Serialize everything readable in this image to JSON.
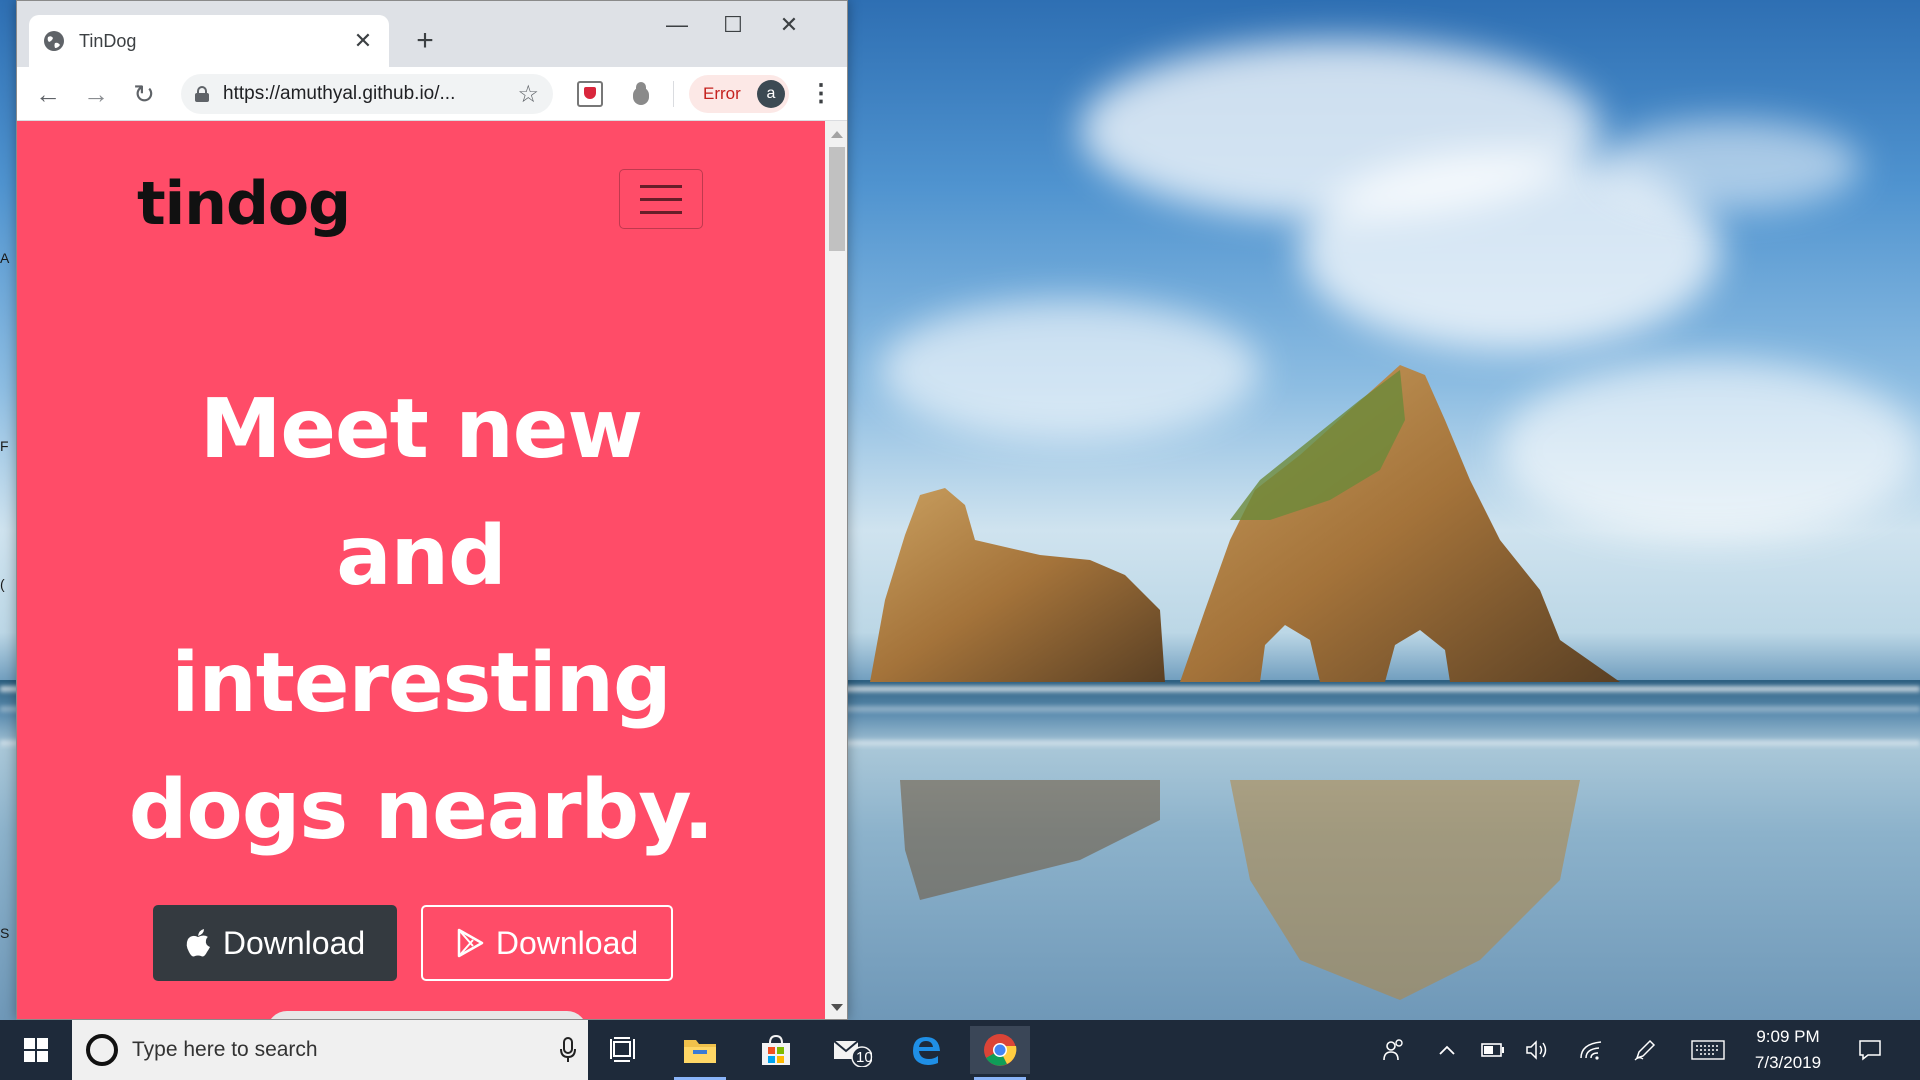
{
  "browser": {
    "tab_title": "TinDog",
    "tab_close": "✕",
    "new_tab": "+",
    "url": "https://amuthyal.github.io/...",
    "error_label": "Error",
    "profile_initial": "a",
    "window_controls": {
      "minimize": "—",
      "maximize": "☐",
      "close": "✕"
    },
    "nav": {
      "back": "←",
      "forward": "→",
      "reload": "↻",
      "bookmark": "☆",
      "menu": "⋮"
    }
  },
  "page": {
    "brand": "tindog",
    "headline_lines": [
      "Meet new",
      "and",
      "interesting",
      "dogs nearby."
    ],
    "btn_apple_label": "Download",
    "btn_play_label": "Download",
    "accent_color": "#ff4c68",
    "dark_button_color": "#343a40"
  },
  "desktop": {
    "edge_letters": [
      "A",
      "F",
      "(",
      "S"
    ]
  },
  "taskbar": {
    "search_placeholder": "Type here to search",
    "mail_badge": "10",
    "time": "9:09 PM",
    "date": "7/3/2019"
  }
}
